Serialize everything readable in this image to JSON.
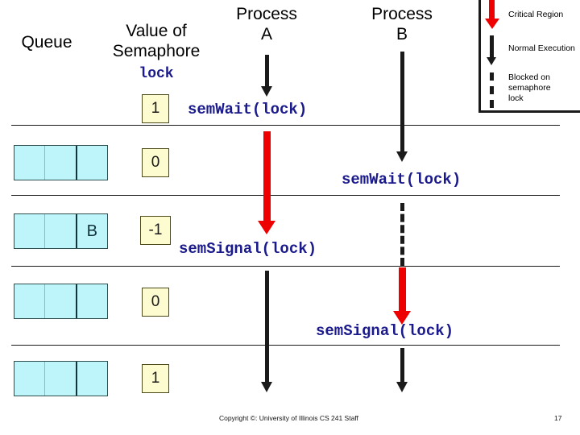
{
  "headers": {
    "queue": "Queue",
    "value_of_semaphore": "Value of\nSemaphore",
    "lock": "lock",
    "process_a": "Process\nA",
    "process_b": "Process\nB"
  },
  "queue_rows": [
    {
      "cells": [
        "",
        "",
        ""
      ]
    },
    {
      "cells": [
        "",
        "",
        "B"
      ]
    },
    {
      "cells": [
        "",
        "",
        ""
      ]
    },
    {
      "cells": [
        "",
        "",
        ""
      ]
    }
  ],
  "semaphore_values": [
    "1",
    "0",
    "-1",
    "0",
    "1"
  ],
  "code_labels": {
    "a_wait": "semWait(lock)",
    "b_wait": "semWait(lock)",
    "a_signal": "semSignal(lock)",
    "b_signal": "semSignal(lock)"
  },
  "legend": {
    "critical_region": "Critical Region",
    "normal_execution": "Normal Execution",
    "blocked": "Blocked on\nsemaphore\nlock"
  },
  "footer": {
    "copyright": "Copyright ©: University of Illinois CS 241 Staff",
    "page": "17"
  },
  "colors": {
    "critical_region": "#ee0000",
    "normal_execution": "#1a1a1a",
    "queue_cell": "#bdf5fb",
    "value_box": "#fdfbd0",
    "code_text": "#1a1a8c"
  }
}
